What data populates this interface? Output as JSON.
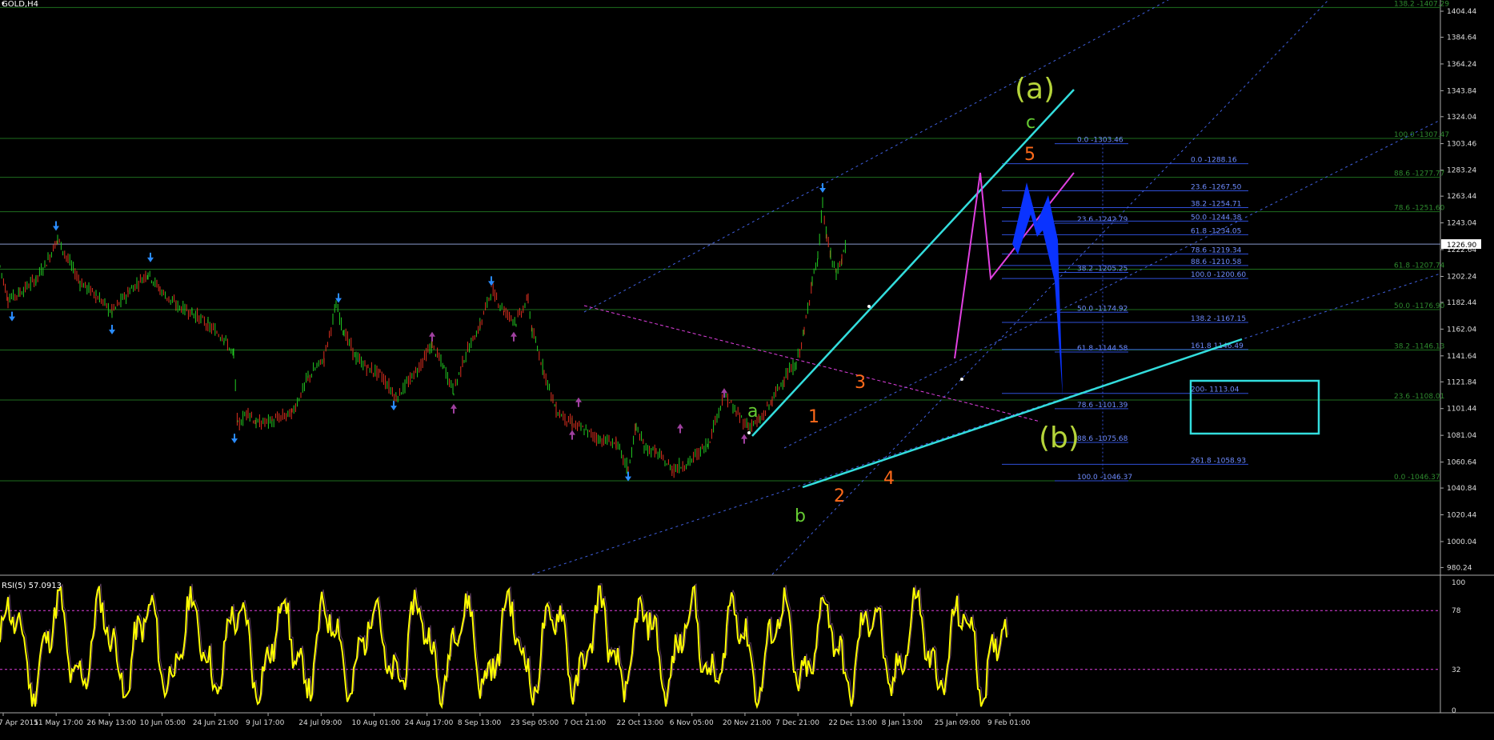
{
  "header": {
    "symbol": "GOLD,H4",
    "rsi_label": "RSI(5) 57.0913"
  },
  "colors": {
    "bg": "#000000",
    "bull": "#22cc22",
    "bear": "#e03020",
    "grid_green": "#1e6e1e",
    "fib_blue": "#2f4fd8",
    "fib_label": "#6f8cff",
    "fib_green_label": "#2e8b2e",
    "cyan": "#33dddd",
    "magenta": "#e040e0",
    "wave_green": "#66cc33",
    "wave_lime": "#b5d43a",
    "wave_orange": "#ff6a1a",
    "rsi": "#ffff00",
    "fractal_up": "#2a8cff",
    "fractal_dn": "#a040a0"
  },
  "chart_data": [
    {
      "type": "candlestick",
      "title": "GOLD,H4",
      "ylim": [
        975,
        1413
      ],
      "current_price": "1226.90",
      "y_ticks": [
        "1404.44",
        "1384.64",
        "1364.24",
        "1343.84",
        "1324.04",
        "1303.46",
        "1283.24",
        "1263.44",
        "1243.04",
        "1222.64",
        "1202.24",
        "1182.44",
        "1162.04",
        "1141.64",
        "1121.84",
        "1101.44",
        "1081.04",
        "1060.64",
        "1040.84",
        "1020.44",
        "1000.04",
        "980.24"
      ],
      "x_ticks": [
        "7 Apr 2015",
        "11 May 17:00",
        "26 May 13:00",
        "10 Jun 05:00",
        "24 Jun 21:00",
        "9 Jul 17:00",
        "24 Jul 09:00",
        "10 Aug 01:00",
        "24 Aug 17:00",
        "8 Sep 13:00",
        "23 Sep 05:00",
        "7 Oct 21:00",
        "22 Oct 13:00",
        "6 Nov 05:00",
        "20 Nov 21:00",
        "7 Dec 21:00",
        "22 Dec 13:00",
        "8 Jan 13:00",
        "25 Jan 09:00",
        "9 Feb 01:00"
      ],
      "price_path": [
        [
          0,
          1210
        ],
        [
          10,
          1185
        ],
        [
          25,
          1190
        ],
        [
          45,
          1200
        ],
        [
          60,
          1215
        ],
        [
          72,
          1231
        ],
        [
          85,
          1215
        ],
        [
          100,
          1198
        ],
        [
          120,
          1188
        ],
        [
          140,
          1175
        ],
        [
          160,
          1190
        ],
        [
          185,
          1205
        ],
        [
          200,
          1192
        ],
        [
          220,
          1180
        ],
        [
          240,
          1175
        ],
        [
          260,
          1165
        ],
        [
          280,
          1155
        ],
        [
          292,
          1142
        ],
        [
          297,
          1088
        ],
        [
          310,
          1100
        ],
        [
          320,
          1090
        ],
        [
          340,
          1092
        ],
        [
          365,
          1098
        ],
        [
          385,
          1125
        ],
        [
          405,
          1140
        ],
        [
          420,
          1180
        ],
        [
          430,
          1160
        ],
        [
          445,
          1140
        ],
        [
          460,
          1132
        ],
        [
          475,
          1128
        ],
        [
          495,
          1110
        ],
        [
          515,
          1125
        ],
        [
          540,
          1150
        ],
        [
          555,
          1132
        ],
        [
          567,
          1115
        ],
        [
          580,
          1140
        ],
        [
          600,
          1165
        ],
        [
          614,
          1192
        ],
        [
          630,
          1176
        ],
        [
          645,
          1168
        ],
        [
          660,
          1185
        ],
        [
          665,
          1160
        ],
        [
          680,
          1130
        ],
        [
          695,
          1100
        ],
        [
          715,
          1090
        ],
        [
          730,
          1085
        ],
        [
          750,
          1078
        ],
        [
          770,
          1075
        ],
        [
          785,
          1055
        ],
        [
          795,
          1088
        ],
        [
          805,
          1072
        ],
        [
          820,
          1068
        ],
        [
          840,
          1055
        ],
        [
          860,
          1060
        ],
        [
          885,
          1075
        ],
        [
          905,
          1113
        ],
        [
          920,
          1098
        ],
        [
          935,
          1088
        ],
        [
          950,
          1092
        ],
        [
          965,
          1108
        ],
        [
          980,
          1125
        ],
        [
          995,
          1135
        ],
        [
          1005,
          1160
        ],
        [
          1015,
          1200
        ],
        [
          1022,
          1215
        ],
        [
          1028,
          1258
        ],
        [
          1033,
          1232
        ],
        [
          1038,
          1218
        ],
        [
          1045,
          1205
        ],
        [
          1052,
          1215
        ],
        [
          1058,
          1230
        ]
      ],
      "up_fractals": [
        [
          15,
          1168
        ],
        [
          70,
          1237
        ],
        [
          140,
          1158
        ],
        [
          188,
          1213
        ],
        [
          293,
          1075
        ],
        [
          423,
          1182
        ],
        [
          492,
          1100
        ],
        [
          614,
          1195
        ],
        [
          785,
          1046
        ],
        [
          1028,
          1266
        ]
      ],
      "down_fractals": [
        [
          540,
          1160
        ],
        [
          567,
          1105
        ],
        [
          642,
          1160
        ],
        [
          715,
          1085
        ],
        [
          723,
          1110
        ],
        [
          850,
          1090
        ],
        [
          905,
          1117
        ],
        [
          930,
          1082
        ]
      ],
      "h_levels_green": [
        {
          "price": 1407.29,
          "label": "138.2 -1407.29"
        },
        {
          "price": 1307.47,
          "label": "100.0 -1307.47"
        },
        {
          "price": 1277.77,
          "label": "88.6 -1277.77"
        },
        {
          "price": 1251.6,
          "label": "78.6 -1251.60"
        },
        {
          "price": 1207.74,
          "label": "61.8 -1207.74"
        },
        {
          "price": 1176.9,
          "label": "50.0 -1176.90"
        },
        {
          "price": 1146.13,
          "label": "38.2 -1146.13"
        },
        {
          "price": 1108.01,
          "label": "23.6 -1108.01"
        },
        {
          "price": 1046.37,
          "label": "0.0 -1046.37"
        }
      ],
      "fib_retracement": [
        {
          "price": 1303.46,
          "label": "0.0 -1303.46"
        },
        {
          "price": 1242.79,
          "label": "23.6 -1242.79"
        },
        {
          "price": 1205.25,
          "label": "38.2 -1205.25"
        },
        {
          "price": 1174.92,
          "label": "50.0 -1174.92"
        },
        {
          "price": 1144.58,
          "label": "61.8 -1144.58"
        },
        {
          "price": 1101.39,
          "label": "78.6 -1101.39"
        },
        {
          "price": 1075.68,
          "label": "88.6 -1075.68"
        },
        {
          "price": 1046.37,
          "label": "100.0 -1046.37"
        }
      ],
      "fib_extension": [
        {
          "price": 1288.16,
          "label": "0.0 -1288.16"
        },
        {
          "price": 1267.5,
          "label": "23.6 -1267.50"
        },
        {
          "price": 1254.71,
          "label": "38.2 -1254.71"
        },
        {
          "price": 1244.38,
          "label": "50.0 -1244.38"
        },
        {
          "price": 1234.05,
          "label": "61.8 -1234.05"
        },
        {
          "price": 1219.34,
          "label": "78.6 -1219.34"
        },
        {
          "price": 1210.58,
          "label": "88.6 -1210.58"
        },
        {
          "price": 1200.6,
          "label": "100.0 -1200.60"
        },
        {
          "price": 1167.15,
          "label": "138.2 -1167.15"
        },
        {
          "price": 1146.49,
          "label": "161.8 1146.49"
        },
        {
          "price": 1113.04,
          "label": "200- 1113.04"
        },
        {
          "price": 1058.93,
          "label": "261.8 -1058.93"
        }
      ],
      "wave_labels": [
        {
          "text": "(a)",
          "color": "lime",
          "big": true
        },
        {
          "text": "(b)",
          "color": "lime",
          "big": true
        },
        {
          "text": "a",
          "color": "green"
        },
        {
          "text": "b",
          "color": "green"
        },
        {
          "text": "c",
          "color": "green"
        },
        {
          "text": "1",
          "color": "orange"
        },
        {
          "text": "2",
          "color": "orange"
        },
        {
          "text": "3",
          "color": "orange"
        },
        {
          "text": "4",
          "color": "orange"
        },
        {
          "text": "5",
          "color": "orange"
        }
      ]
    },
    {
      "type": "line",
      "title": "RSI(5) 57.0913",
      "ylim": [
        0,
        100
      ],
      "y_ticks": [
        "100",
        "78",
        "32",
        "0"
      ],
      "levels": [
        78,
        32
      ],
      "last_value": 57.0913
    }
  ]
}
